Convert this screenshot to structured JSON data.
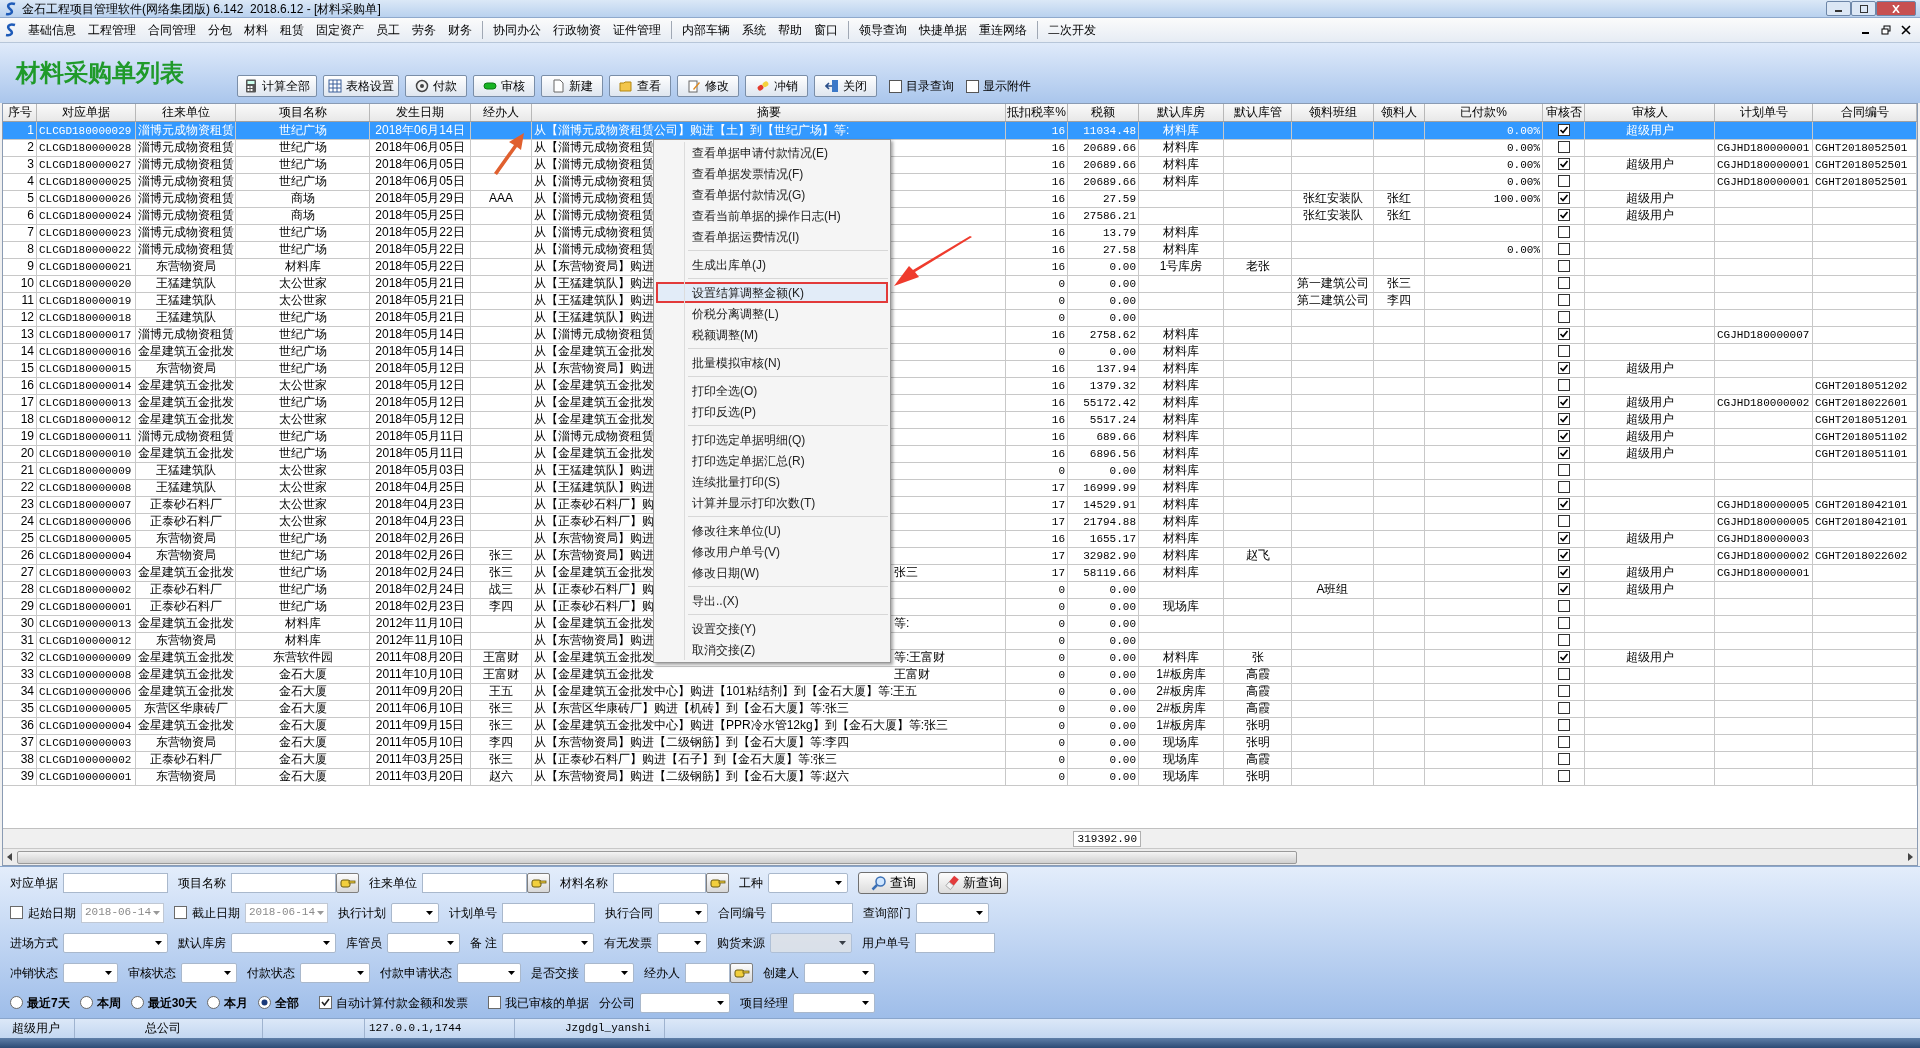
{
  "window": {
    "title": "金石工程项目管理软件(网络集团版) 6.142  2018.6.12 - [材料采购单]"
  },
  "menu": [
    [
      "基础信息",
      "工程管理",
      "合同管理",
      "分包",
      "材料",
      "租赁",
      "固定资产",
      "员工",
      "劳务",
      "财务"
    ],
    [
      "协同办公",
      "行政物资",
      "证件管理"
    ],
    [
      "内部车辆",
      "系统",
      "帮助",
      "窗口"
    ],
    [
      "领导查询",
      "快捷单据",
      "重连网络"
    ],
    [
      "二次开发"
    ]
  ],
  "toolbar": {
    "title": "材料采购单列表",
    "buttons": [
      "计算全部",
      "表格设置",
      "付款",
      "审核",
      "新建",
      "查看",
      "修改",
      "冲销",
      "关闭"
    ],
    "checkboxes": [
      {
        "label": "目录查询",
        "checked": false
      },
      {
        "label": "显示附件",
        "checked": false
      }
    ]
  },
  "table": {
    "columns": [
      "序号",
      "对应单据",
      "往来单位",
      "项目名称",
      "发生日期",
      "经办人",
      "摘要",
      "抵扣税率%",
      "税额",
      "默认库房",
      "默认库管",
      "领料班组",
      "领料人",
      "已付款%",
      "审核否",
      "审核人",
      "计划单号",
      "合同编号"
    ],
    "rows": [
      {
        "selected": true,
        "audited": true,
        "cells": [
          "1",
          "CLCGD180000029",
          "淄博元成物资租赁",
          "世纪广场",
          "2018年06月14日",
          "",
          "从【淄博元成物资租赁公司】购进【土】到【世纪广场】等:",
          "16",
          "11034.48",
          "材料库",
          "",
          "",
          "",
          "0.00%",
          "",
          "超级用户",
          "",
          ""
        ]
      },
      {
        "selected": false,
        "audited": false,
        "cells": [
          "2",
          "CLCGD180000028",
          "淄博元成物资租赁",
          "世纪广场",
          "2018年06月05日",
          "",
          "从【淄博元成物资租赁",
          "16",
          "20689.66",
          "材料库",
          "",
          "",
          "",
          "0.00%",
          "",
          "",
          "CGJHD180000001",
          "CGHT2018052501"
        ]
      },
      {
        "selected": false,
        "audited": true,
        "cells": [
          "3",
          "CLCGD180000027",
          "淄博元成物资租赁",
          "世纪广场",
          "2018年06月05日",
          "",
          "从【淄博元成物资租赁",
          "16",
          "20689.66",
          "材料库",
          "",
          "",
          "",
          "0.00%",
          "",
          "超级用户",
          "CGJHD180000001",
          "CGHT2018052501"
        ]
      },
      {
        "selected": false,
        "audited": false,
        "cells": [
          "4",
          "CLCGD180000025",
          "淄博元成物资租赁",
          "世纪广场",
          "2018年06月05日",
          "",
          "从【淄博元成物资租赁",
          "16",
          "20689.66",
          "材料库",
          "",
          "",
          "",
          "0.00%",
          "",
          "",
          "CGJHD180000001",
          "CGHT2018052501"
        ]
      },
      {
        "selected": false,
        "audited": true,
        "cells": [
          "5",
          "CLCGD180000026",
          "淄博元成物资租赁",
          "商场",
          "2018年05月29日",
          "AAA",
          "从【淄博元成物资租赁",
          "16",
          "27.59",
          "",
          "",
          "张红安装队",
          "张红",
          "100.00%",
          "",
          "超级用户",
          "",
          ""
        ]
      },
      {
        "selected": false,
        "audited": true,
        "cells": [
          "6",
          "CLCGD180000024",
          "淄博元成物资租赁",
          "商场",
          "2018年05月25日",
          "",
          "从【淄博元成物资租赁",
          "16",
          "27586.21",
          "",
          "",
          "张红安装队",
          "张红",
          "",
          "",
          "超级用户",
          "",
          ""
        ]
      },
      {
        "selected": false,
        "audited": false,
        "cells": [
          "7",
          "CLCGD180000023",
          "淄博元成物资租赁",
          "世纪广场",
          "2018年05月22日",
          "",
          "从【淄博元成物资租赁",
          "16",
          "13.79",
          "材料库",
          "",
          "",
          "",
          "",
          "",
          "",
          "",
          ""
        ]
      },
      {
        "selected": false,
        "audited": false,
        "cells": [
          "8",
          "CLCGD180000022",
          "淄博元成物资租赁",
          "世纪广场",
          "2018年05月22日",
          "",
          "从【淄博元成物资租赁",
          "16",
          "27.58",
          "材料库",
          "",
          "",
          "",
          "0.00%",
          "",
          "",
          "",
          ""
        ]
      },
      {
        "selected": false,
        "audited": false,
        "cells": [
          "9",
          "CLCGD180000021",
          "东营物资局",
          "材料库",
          "2018年05月22日",
          "",
          "从【东营物资局】购进",
          "16",
          "0.00",
          "1号库房",
          "老张",
          "",
          "",
          "",
          "",
          "",
          "",
          ""
        ]
      },
      {
        "selected": false,
        "audited": false,
        "cells": [
          "10",
          "CLCGD180000020",
          "王猛建筑队",
          "太公世家",
          "2018年05月21日",
          "",
          "从【王猛建筑队】购进",
          "0",
          "0.00",
          "",
          "",
          "第一建筑公司",
          "张三",
          "",
          "",
          "",
          "",
          ""
        ]
      },
      {
        "selected": false,
        "audited": false,
        "cells": [
          "11",
          "CLCGD180000019",
          "王猛建筑队",
          "太公世家",
          "2018年05月21日",
          "",
          "从【王猛建筑队】购进",
          "0",
          "0.00",
          "",
          "",
          "第二建筑公司",
          "李四",
          "",
          "",
          "",
          "",
          ""
        ]
      },
      {
        "selected": false,
        "audited": false,
        "cells": [
          "12",
          "CLCGD180000018",
          "王猛建筑队",
          "世纪广场",
          "2018年05月21日",
          "",
          "从【王猛建筑队】购进",
          "0",
          "0.00",
          "",
          "",
          "",
          "",
          "",
          "",
          "",
          "",
          ""
        ]
      },
      {
        "selected": false,
        "audited": true,
        "cells": [
          "13",
          "CLCGD180000017",
          "淄博元成物资租赁",
          "世纪广场",
          "2018年05月14日",
          "",
          "从【淄博元成物资租赁",
          "16",
          "2758.62",
          "材料库",
          "",
          "",
          "",
          "",
          "",
          "",
          "CGJHD180000007",
          ""
        ]
      },
      {
        "selected": false,
        "audited": false,
        "cells": [
          "14",
          "CLCGD180000016",
          "金星建筑五金批发",
          "世纪广场",
          "2018年05月14日",
          "",
          "从【金星建筑五金批发",
          "0",
          "0.00",
          "材料库",
          "",
          "",
          "",
          "",
          "",
          "",
          "",
          ""
        ]
      },
      {
        "selected": false,
        "audited": true,
        "cells": [
          "15",
          "CLCGD180000015",
          "东营物资局",
          "世纪广场",
          "2018年05月12日",
          "",
          "从【东营物资局】购进",
          "16",
          "137.94",
          "材料库",
          "",
          "",
          "",
          "",
          "",
          "超级用户",
          "",
          ""
        ]
      },
      {
        "selected": false,
        "audited": false,
        "cells": [
          "16",
          "CLCGD180000014",
          "金星建筑五金批发",
          "太公世家",
          "2018年05月12日",
          "",
          "从【金星建筑五金批发",
          "16",
          "1379.32",
          "材料库",
          "",
          "",
          "",
          "",
          "",
          "",
          "",
          "CGHT2018051202"
        ]
      },
      {
        "selected": false,
        "audited": true,
        "cells": [
          "17",
          "CLCGD180000013",
          "金星建筑五金批发",
          "世纪广场",
          "2018年05月12日",
          "",
          "从【金星建筑五金批发",
          "16",
          "55172.42",
          "材料库",
          "",
          "",
          "",
          "",
          "",
          "超级用户",
          "CGJHD180000002",
          "CGHT2018022601"
        ]
      },
      {
        "selected": false,
        "audited": true,
        "cells": [
          "18",
          "CLCGD180000012",
          "金星建筑五金批发",
          "太公世家",
          "2018年05月12日",
          "",
          "从【金星建筑五金批发",
          "16",
          "5517.24",
          "材料库",
          "",
          "",
          "",
          "",
          "",
          "超级用户",
          "",
          "CGHT2018051201"
        ]
      },
      {
        "selected": false,
        "audited": true,
        "cells": [
          "19",
          "CLCGD180000011",
          "淄博元成物资租赁",
          "世纪广场",
          "2018年05月11日",
          "",
          "从【淄博元成物资租赁",
          "16",
          "689.66",
          "材料库",
          "",
          "",
          "",
          "",
          "",
          "超级用户",
          "",
          "CGHT2018051102"
        ]
      },
      {
        "selected": false,
        "audited": true,
        "cells": [
          "20",
          "CLCGD180000010",
          "金星建筑五金批发",
          "世纪广场",
          "2018年05月11日",
          "",
          "从【金星建筑五金批发",
          "16",
          "6896.56",
          "材料库",
          "",
          "",
          "",
          "",
          "",
          "超级用户",
          "",
          "CGHT2018051101"
        ]
      },
      {
        "selected": false,
        "audited": false,
        "cells": [
          "21",
          "CLCGD180000009",
          "王猛建筑队",
          "太公世家",
          "2018年05月03日",
          "",
          "从【王猛建筑队】购进",
          "0",
          "0.00",
          "材料库",
          "",
          "",
          "",
          "",
          "",
          "",
          "",
          ""
        ]
      },
      {
        "selected": false,
        "audited": false,
        "cells": [
          "22",
          "CLCGD180000008",
          "王猛建筑队",
          "太公世家",
          "2018年04月25日",
          "",
          "从【王猛建筑队】购进",
          "17",
          "16999.99",
          "材料库",
          "",
          "",
          "",
          "",
          "",
          "",
          "",
          ""
        ]
      },
      {
        "selected": false,
        "audited": true,
        "cells": [
          "23",
          "CLCGD180000007",
          "正泰砂石料厂",
          "太公世家",
          "2018年04月23日",
          "",
          "从【正泰砂石料厂】购",
          "17",
          "14529.91",
          "材料库",
          "",
          "",
          "",
          "",
          "",
          "",
          "CGJHD180000005",
          "CGHT2018042101"
        ]
      },
      {
        "selected": false,
        "audited": false,
        "cells": [
          "24",
          "CLCGD180000006",
          "正泰砂石料厂",
          "太公世家",
          "2018年04月23日",
          "",
          "从【正泰砂石料厂】购",
          "17",
          "21794.88",
          "材料库",
          "",
          "",
          "",
          "",
          "",
          "",
          "CGJHD180000005",
          "CGHT2018042101"
        ]
      },
      {
        "selected": false,
        "audited": true,
        "cells": [
          "25",
          "CLCGD180000005",
          "东营物资局",
          "世纪广场",
          "2018年02月26日",
          "",
          "从【东营物资局】购进",
          "16",
          "1655.17",
          "材料库",
          "",
          "",
          "",
          "",
          "",
          "超级用户",
          "CGJHD180000003",
          ""
        ]
      },
      {
        "selected": false,
        "audited": true,
        "cells": [
          "26",
          "CLCGD180000004",
          "东营物资局",
          "世纪广场",
          "2018年02月26日",
          "张三",
          "从【东营物资局】购进",
          "17",
          "32982.90",
          "材料库",
          "赵飞",
          "",
          "",
          "",
          "",
          "",
          "CGJHD180000002",
          "CGHT2018022602"
        ]
      },
      {
        "selected": false,
        "audited": true,
        "summary_tail": "张三",
        "cells": [
          "27",
          "CLCGD180000003",
          "金星建筑五金批发",
          "世纪广场",
          "2018年02月24日",
          "张三",
          "从【金星建筑五金批发",
          "17",
          "58119.66",
          "材料库",
          "",
          "",
          "",
          "",
          "",
          "超级用户",
          "CGJHD180000001",
          ""
        ]
      },
      {
        "selected": false,
        "audited": true,
        "cells": [
          "28",
          "CLCGD180000002",
          "正泰砂石料厂",
          "世纪广场",
          "2018年02月24日",
          "战三",
          "从【正泰砂石料厂】购",
          "0",
          "0.00",
          "",
          "",
          "A班组",
          "",
          "",
          "",
          "超级用户",
          "",
          ""
        ]
      },
      {
        "selected": false,
        "audited": false,
        "cells": [
          "29",
          "CLCGD180000001",
          "正泰砂石料厂",
          "世纪广场",
          "2018年02月23日",
          "李四",
          "从【正泰砂石料厂】购",
          "0",
          "0.00",
          "现场库",
          "",
          "",
          "",
          "",
          "",
          "",
          "",
          ""
        ]
      },
      {
        "selected": false,
        "audited": false,
        "summary_tail": "等:",
        "cells": [
          "30",
          "CLCGD100000013",
          "金星建筑五金批发",
          "材料库",
          "2012年11月10日",
          "",
          "从【金星建筑五金批发",
          "0",
          "0.00",
          "",
          "",
          "",
          "",
          "",
          "",
          "",
          "",
          ""
        ]
      },
      {
        "selected": false,
        "audited": false,
        "cells": [
          "31",
          "CLCGD100000012",
          "东营物资局",
          "材料库",
          "2012年11月10日",
          "",
          "从【东营物资局】购进",
          "0",
          "0.00",
          "",
          "",
          "",
          "",
          "",
          "",
          "",
          "",
          ""
        ]
      },
      {
        "selected": false,
        "audited": true,
        "summary_tail": "等:王富财",
        "cells": [
          "32",
          "CLCGD100000009",
          "金星建筑五金批发",
          "东营软件园",
          "2011年08月20日",
          "王富财",
          "从【金星建筑五金批发",
          "0",
          "0.00",
          "材料库",
          "张",
          "",
          "",
          "",
          "",
          "超级用户",
          "",
          ""
        ]
      },
      {
        "selected": false,
        "audited": false,
        "summary_tail": "王富财",
        "cells": [
          "33",
          "CLCGD100000008",
          "金星建筑五金批发",
          "金石大厦",
          "2011年10月10日",
          "王富财",
          "从【金星建筑五金批发",
          "0",
          "0.00",
          "1#板房库",
          "高霞",
          "",
          "",
          "",
          "",
          "",
          "",
          ""
        ]
      },
      {
        "selected": false,
        "audited": false,
        "cells": [
          "34",
          "CLCGD100000006",
          "金星建筑五金批发",
          "金石大厦",
          "2011年09月20日",
          "王五",
          "从【金星建筑五金批发中心】购进【101粘结剂】到【金石大厦】等:王五",
          "0",
          "0.00",
          "2#板房库",
          "高霞",
          "",
          "",
          "",
          "",
          "",
          "",
          ""
        ]
      },
      {
        "selected": false,
        "audited": false,
        "cells": [
          "35",
          "CLCGD100000005",
          "东营区华康砖厂",
          "金石大厦",
          "2011年06月10日",
          "张三",
          "从【东营区华康砖厂】购进【机砖】到【金石大厦】等:张三",
          "0",
          "0.00",
          "2#板房库",
          "高霞",
          "",
          "",
          "",
          "",
          "",
          "",
          ""
        ]
      },
      {
        "selected": false,
        "audited": false,
        "cells": [
          "36",
          "CLCGD100000004",
          "金星建筑五金批发",
          "金石大厦",
          "2011年09月15日",
          "张三",
          "从【金星建筑五金批发中心】购进【PPR冷水管12kg】到【金石大厦】等:张三",
          "0",
          "0.00",
          "1#板房库",
          "张明",
          "",
          "",
          "",
          "",
          "",
          "",
          ""
        ]
      },
      {
        "selected": false,
        "audited": false,
        "cells": [
          "37",
          "CLCGD100000003",
          "东营物资局",
          "金石大厦",
          "2011年05月10日",
          "李四",
          "从【东营物资局】购进【二级钢筋】到【金石大厦】等:李四",
          "0",
          "0.00",
          "现场库",
          "张明",
          "",
          "",
          "",
          "",
          "",
          "",
          ""
        ]
      },
      {
        "selected": false,
        "audited": false,
        "cells": [
          "38",
          "CLCGD100000002",
          "正泰砂石料厂",
          "金石大厦",
          "2011年03月25日",
          "张三",
          "从【正泰砂石料厂】购进【石子】到【金石大厦】等:张三",
          "0",
          "0.00",
          "现场库",
          "高霞",
          "",
          "",
          "",
          "",
          "",
          "",
          ""
        ]
      },
      {
        "selected": false,
        "audited": false,
        "cells": [
          "39",
          "CLCGD100000001",
          "东营物资局",
          "金石大厦",
          "2011年03月20日",
          "赵六",
          "从【东营物资局】购进【二级钢筋】到【金石大厦】等:赵六",
          "0",
          "0.00",
          "现场库",
          "张明",
          "",
          "",
          "",
          "",
          "",
          "",
          ""
        ]
      }
    ],
    "total_tax": "319392.90"
  },
  "context_menu": [
    [
      {
        "label": "查看单据申请付款情况(E)",
        "selected": false
      },
      {
        "label": "查看单据发票情况(F)",
        "selected": false
      },
      {
        "label": "查看单据付款情况(G)",
        "selected": false
      },
      {
        "label": "查看当前单据的操作日志(H)",
        "selected": false
      },
      {
        "label": "查看单据运费情况(I)",
        "selected": false
      }
    ],
    [
      {
        "label": "生成出库单(J)",
        "selected": false
      }
    ],
    [
      {
        "label": "设置结算调整金额(K)",
        "selected": true
      },
      {
        "label": "价税分离调整(L)",
        "selected": false
      },
      {
        "label": "税额调整(M)",
        "selected": false
      }
    ],
    [
      {
        "label": "批量模拟审核(N)",
        "selected": false
      }
    ],
    [
      {
        "label": "打印全选(O)",
        "selected": false
      },
      {
        "label": "打印反选(P)",
        "selected": false
      }
    ],
    [
      {
        "label": "打印选定单据明细(Q)",
        "selected": false
      },
      {
        "label": "打印选定单据汇总(R)",
        "selected": false
      },
      {
        "label": "连续批量打印(S)",
        "selected": false
      },
      {
        "label": "计算并显示打印次数(T)",
        "selected": false
      }
    ],
    [
      {
        "label": "修改往来单位(U)",
        "selected": false
      },
      {
        "label": "修改用户单号(V)",
        "selected": false
      },
      {
        "label": "修改日期(W)",
        "selected": false
      }
    ],
    [
      {
        "label": "导出..(X)",
        "selected": false
      }
    ],
    [
      {
        "label": "设置交接(Y)",
        "selected": false
      },
      {
        "label": "取消交接(Z)",
        "selected": false
      }
    ]
  ],
  "filters": [
    [
      {
        "kind": "text",
        "label": "对应单据"
      },
      {
        "kind": "lookup",
        "label": "项目名称"
      },
      {
        "kind": "lookup",
        "label": "往来单位"
      },
      {
        "kind": "lookup",
        "label": "材料名称"
      },
      {
        "kind": "combo",
        "label": "工种",
        "disabled": false
      },
      {
        "kind": "button",
        "label": "查询"
      },
      {
        "kind": "button",
        "label": "新查询"
      }
    ],
    [
      {
        "kind": "date",
        "label": "起始日期",
        "checked": false,
        "value": "2018-06-14"
      },
      {
        "kind": "date",
        "label": "截止日期",
        "checked": false,
        "value": "2018-06-14"
      },
      {
        "kind": "combo",
        "label": "执行计划",
        "disabled": false
      },
      {
        "kind": "text",
        "label": "计划单号"
      },
      {
        "kind": "combo",
        "label": "执行合同",
        "disabled": false
      },
      {
        "kind": "text",
        "label": "合同编号"
      },
      {
        "kind": "combo",
        "label": "查询部门",
        "disabled": false
      }
    ],
    [
      {
        "kind": "combo",
        "label": "进场方式",
        "disabled": false
      },
      {
        "kind": "combo",
        "label": "默认库房",
        "disabled": false
      },
      {
        "kind": "combo",
        "label": "库管员",
        "disabled": false
      },
      {
        "kind": "combo",
        "label": "备 注",
        "disabled": false
      },
      {
        "kind": "combo",
        "label": "有无发票",
        "disabled": false
      },
      {
        "kind": "combo",
        "label": "购货来源",
        "disabled": true
      },
      {
        "kind": "text",
        "label": "用户单号"
      }
    ],
    [
      {
        "kind": "combo",
        "label": "冲销状态",
        "disabled": false
      },
      {
        "kind": "combo",
        "label": "审核状态",
        "disabled": false
      },
      {
        "kind": "combo",
        "label": "付款状态",
        "disabled": false
      },
      {
        "kind": "combo",
        "label": "付款申请状态",
        "disabled": false
      },
      {
        "kind": "combo",
        "label": "是否交接",
        "disabled": false
      },
      {
        "kind": "lookup",
        "label": "经办人"
      },
      {
        "kind": "combo",
        "label": "创建人",
        "disabled": false
      }
    ],
    [
      {
        "kind": "radio",
        "label": "最近7天",
        "selected": false
      },
      {
        "kind": "radio",
        "label": "本周",
        "selected": false
      },
      {
        "kind": "radio",
        "label": "最近30天",
        "selected": false
      },
      {
        "kind": "radio",
        "label": "本月",
        "selected": false
      },
      {
        "kind": "radio",
        "label": "全部",
        "selected": true
      },
      {
        "kind": "check",
        "label": "自动计算付款金额和发票",
        "checked": true
      },
      {
        "kind": "check",
        "label": "我已审核的单据",
        "checked": false
      },
      {
        "kind": "combo",
        "label": "分公司",
        "disabled": false
      },
      {
        "kind": "combo",
        "label": "项目经理",
        "disabled": false
      }
    ]
  ],
  "status_bar": [
    "超级用户",
    "总公司",
    "127.0.0.1,1744",
    "Jzgdgl_yanshi"
  ]
}
